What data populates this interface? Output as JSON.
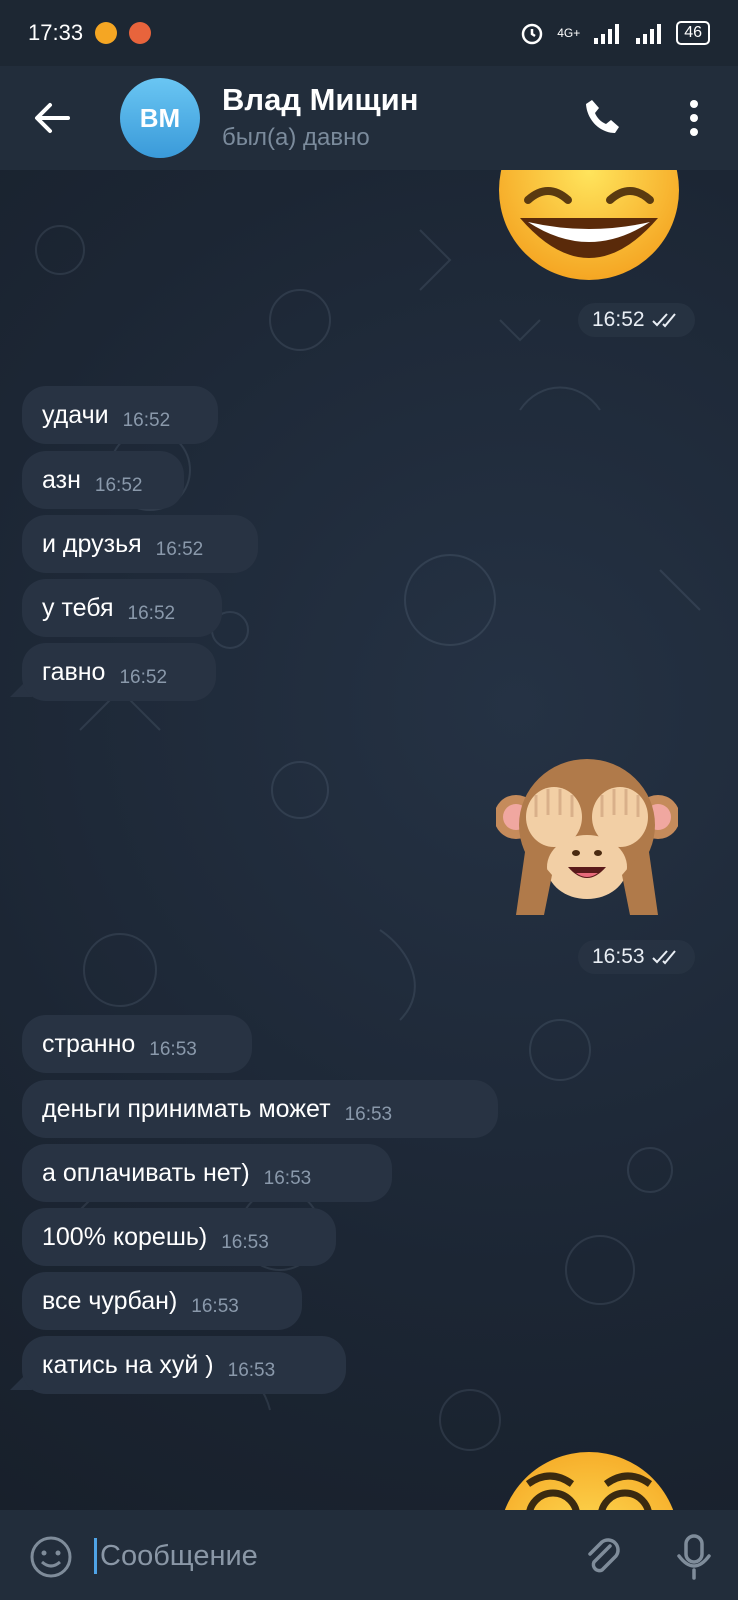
{
  "status_bar": {
    "time": "17:33",
    "network_label": "4G+",
    "battery": "46",
    "icons": [
      "mail-icon",
      "browser-icon",
      "alarm-icon",
      "signal-icon",
      "signal-icon-2",
      "battery-icon"
    ]
  },
  "header": {
    "avatar_initials": "ВМ",
    "name": "Влад Мищин",
    "status": "был(а) давно",
    "icons": [
      "back-arrow-icon",
      "phone-icon",
      "more-vertical-icon"
    ]
  },
  "messages": {
    "sticker_1_time": "16:52",
    "incoming_1": [
      {
        "text": "удачи",
        "time": "16:52"
      },
      {
        "text": "азн",
        "time": "16:52"
      },
      {
        "text": "и друзья",
        "time": "16:52"
      },
      {
        "text": "у тебя",
        "time": "16:52"
      },
      {
        "text": "гавно",
        "time": "16:52"
      }
    ],
    "sticker_2_time": "16:53",
    "incoming_2": [
      {
        "text": "странно",
        "time": "16:53"
      },
      {
        "text": "деньги принимать может",
        "time": "16:53"
      },
      {
        "text": "а оплачивать нет)",
        "time": "16:53"
      },
      {
        "text": "100% корешь)",
        "time": "16:53"
      },
      {
        "text": "все чурбан)",
        "time": "16:53"
      },
      {
        "text": "катись на хуй )",
        "time": "16:53"
      }
    ],
    "read_status_icon": "double-check-icon"
  },
  "input_bar": {
    "placeholder": "Сообщение",
    "icons": [
      "emoji-icon",
      "attach-icon",
      "microphone-icon"
    ]
  },
  "colors": {
    "header_bg": "#222d3b",
    "incoming_bubble": "#283343",
    "accent": "#4fa3e6"
  }
}
